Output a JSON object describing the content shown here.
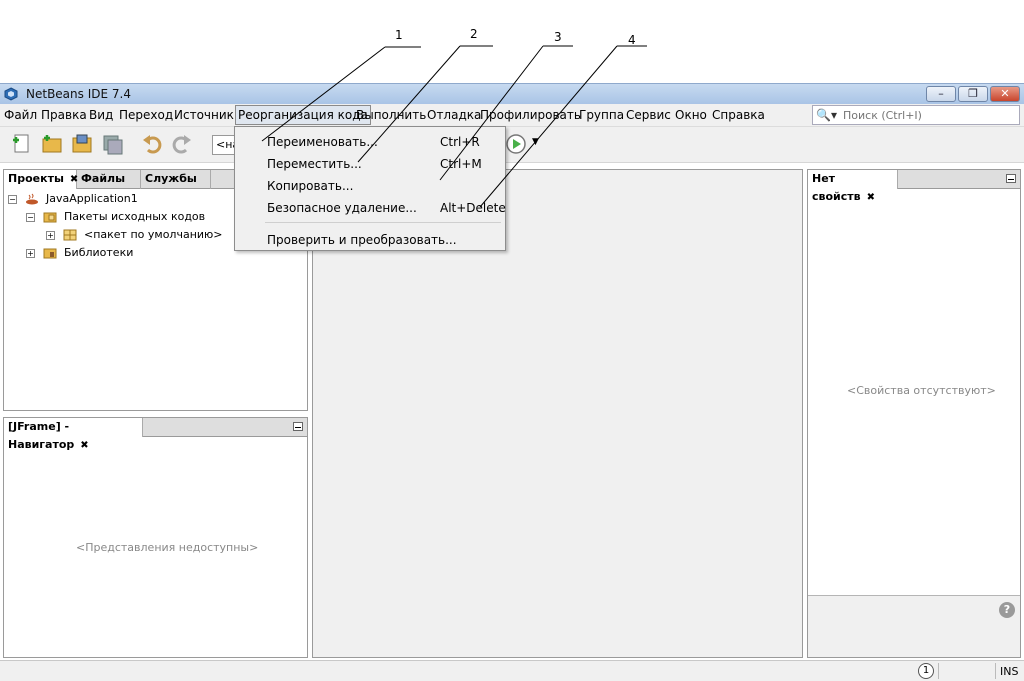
{
  "callouts": [
    "1",
    "2",
    "3",
    "4"
  ],
  "window": {
    "title": "NetBeans IDE 7.4"
  },
  "menubar": {
    "items": [
      "Файл",
      "Правка",
      "Вид",
      "Переход",
      "Источник",
      "Реорганизация кода",
      "Выполнить",
      "Отладка",
      "Профилировать",
      "Группа",
      "Сервис",
      "Окно",
      "Справка"
    ],
    "search_placeholder": "Поиск (Ctrl+I)"
  },
  "toolbar": {
    "config_combo": "<на"
  },
  "dropdown": {
    "items": [
      {
        "label": "Переименовать...",
        "shortcut": "Ctrl+R"
      },
      {
        "label": "Переместить...",
        "shortcut": "Ctrl+M"
      },
      {
        "label": "Копировать...",
        "shortcut": ""
      },
      {
        "label": "Безопасное удаление...",
        "shortcut": "Alt+Delete"
      },
      {
        "label": "Проверить и преобразовать...",
        "shortcut": ""
      }
    ]
  },
  "projects_panel": {
    "tabs": [
      "Проекты",
      "Файлы",
      "Службы"
    ],
    "tree": [
      "JavaApplication1",
      "Пакеты исходных кодов",
      "<пакет по умолчанию>",
      "Библиотеки"
    ]
  },
  "navigator_panel": {
    "title": "[JFrame] - Навигатор",
    "placeholder": "<Представления недоступны>"
  },
  "properties_panel": {
    "title": "Нет свойств",
    "placeholder": "<Свойства отсутствуют>"
  },
  "statusbar": {
    "notifications": "1",
    "mode": "INS"
  },
  "colors": {
    "titlebar": "#b7cfec",
    "menubar": "#f0f0f0",
    "active_menu": "#dfe6ef",
    "folder": "#e8b84a"
  }
}
